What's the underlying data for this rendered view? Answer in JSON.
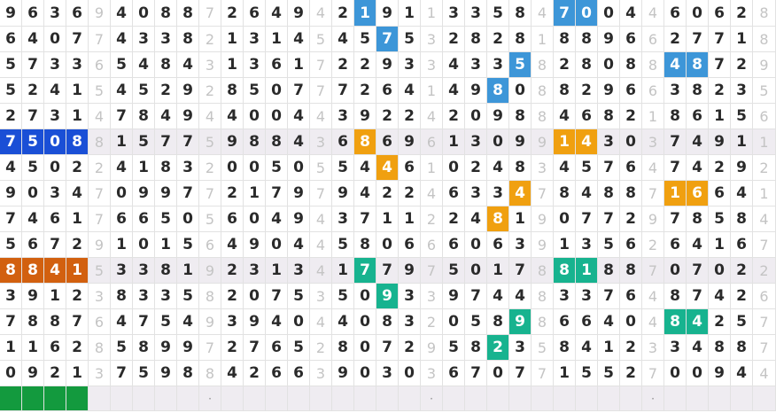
{
  "colors": {
    "blue_light": "#3d96d8",
    "blue_dark": "#1a4fd6",
    "orange": "#f0a010",
    "orange_dark": "#d2600f",
    "teal": "#17b38f",
    "green": "#139a3e",
    "stripe": "#efecf1",
    "white": "#ffffff"
  },
  "grid": {
    "rows": [
      [
        "9",
        "6",
        "3",
        "6",
        "9",
        "4",
        "0",
        "8",
        "8",
        "7",
        "2",
        "6",
        "4",
        "9",
        "4",
        "2",
        "1",
        "9",
        "1",
        "1",
        "3",
        "3",
        "5",
        "8",
        "4",
        "7",
        "0",
        "0",
        "4",
        "4",
        "6",
        "0",
        "6",
        "2",
        "8"
      ],
      [
        "6",
        "4",
        "0",
        "7",
        "7",
        "4",
        "3",
        "3",
        "8",
        "2",
        "1",
        "3",
        "1",
        "4",
        "5",
        "4",
        "5",
        "7",
        "5",
        "3",
        "2",
        "8",
        "2",
        "8",
        "1",
        "8",
        "8",
        "9",
        "6",
        "6",
        "2",
        "7",
        "7",
        "1",
        "8"
      ],
      [
        "5",
        "7",
        "3",
        "3",
        "6",
        "5",
        "4",
        "8",
        "4",
        "3",
        "1",
        "3",
        "6",
        "1",
        "7",
        "2",
        "2",
        "9",
        "3",
        "3",
        "4",
        "3",
        "3",
        "5",
        "8",
        "2",
        "8",
        "0",
        "8",
        "8",
        "4",
        "8",
        "7",
        "2",
        "9"
      ],
      [
        "5",
        "2",
        "4",
        "1",
        "5",
        "4",
        "5",
        "2",
        "9",
        "2",
        "8",
        "5",
        "0",
        "7",
        "7",
        "7",
        "2",
        "6",
        "4",
        "1",
        "4",
        "9",
        "8",
        "0",
        "8",
        "8",
        "2",
        "9",
        "6",
        "6",
        "3",
        "8",
        "2",
        "3",
        "5"
      ],
      [
        "2",
        "7",
        "3",
        "1",
        "4",
        "7",
        "8",
        "4",
        "9",
        "4",
        "4",
        "0",
        "0",
        "4",
        "4",
        "3",
        "9",
        "2",
        "2",
        "4",
        "2",
        "0",
        "9",
        "8",
        "8",
        "4",
        "6",
        "8",
        "2",
        "1",
        "8",
        "6",
        "1",
        "5",
        "6"
      ],
      [
        "7",
        "5",
        "0",
        "8",
        "8",
        "1",
        "5",
        "7",
        "7",
        "5",
        "9",
        "8",
        "8",
        "4",
        "3",
        "6",
        "8",
        "6",
        "9",
        "6",
        "1",
        "3",
        "0",
        "9",
        "9",
        "1",
        "4",
        "3",
        "0",
        "3",
        "7",
        "4",
        "9",
        "1",
        "1"
      ],
      [
        "4",
        "5",
        "0",
        "2",
        "2",
        "4",
        "1",
        "8",
        "3",
        "2",
        "0",
        "0",
        "5",
        "0",
        "5",
        "5",
        "4",
        "4",
        "6",
        "1",
        "0",
        "2",
        "4",
        "8",
        "3",
        "4",
        "5",
        "7",
        "6",
        "4",
        "7",
        "4",
        "2",
        "9",
        "2"
      ],
      [
        "9",
        "0",
        "3",
        "4",
        "7",
        "0",
        "9",
        "9",
        "7",
        "7",
        "2",
        "1",
        "7",
        "9",
        "7",
        "9",
        "4",
        "2",
        "2",
        "4",
        "6",
        "3",
        "3",
        "4",
        "7",
        "8",
        "4",
        "8",
        "8",
        "7",
        "1",
        "6",
        "6",
        "4",
        "1"
      ],
      [
        "7",
        "4",
        "6",
        "1",
        "7",
        "6",
        "6",
        "5",
        "0",
        "5",
        "6",
        "0",
        "4",
        "9",
        "4",
        "3",
        "7",
        "1",
        "1",
        "2",
        "2",
        "4",
        "8",
        "1",
        "9",
        "0",
        "7",
        "7",
        "2",
        "9",
        "7",
        "8",
        "5",
        "8",
        "4"
      ],
      [
        "5",
        "6",
        "7",
        "2",
        "9",
        "1",
        "0",
        "1",
        "5",
        "6",
        "4",
        "9",
        "0",
        "4",
        "4",
        "5",
        "8",
        "0",
        "6",
        "6",
        "6",
        "0",
        "6",
        "3",
        "9",
        "1",
        "3",
        "5",
        "6",
        "2",
        "6",
        "4",
        "1",
        "6",
        "7"
      ],
      [
        "8",
        "8",
        "4",
        "1",
        "5",
        "3",
        "3",
        "8",
        "1",
        "9",
        "2",
        "3",
        "1",
        "3",
        "4",
        "1",
        "7",
        "7",
        "9",
        "7",
        "5",
        "0",
        "1",
        "7",
        "8",
        "8",
        "1",
        "8",
        "8",
        "7",
        "0",
        "7",
        "0",
        "2",
        "2"
      ],
      [
        "3",
        "9",
        "1",
        "2",
        "3",
        "8",
        "3",
        "3",
        "5",
        "8",
        "2",
        "0",
        "7",
        "5",
        "3",
        "5",
        "0",
        "9",
        "3",
        "3",
        "9",
        "7",
        "4",
        "4",
        "8",
        "3",
        "3",
        "7",
        "6",
        "4",
        "8",
        "7",
        "4",
        "2",
        "6"
      ],
      [
        "7",
        "8",
        "8",
        "7",
        "6",
        "4",
        "7",
        "5",
        "4",
        "9",
        "3",
        "9",
        "4",
        "0",
        "4",
        "4",
        "0",
        "8",
        "3",
        "2",
        "0",
        "5",
        "8",
        "9",
        "8",
        "6",
        "6",
        "4",
        "0",
        "4",
        "8",
        "4",
        "2",
        "5",
        "7"
      ],
      [
        "1",
        "1",
        "6",
        "2",
        "8",
        "5",
        "8",
        "9",
        "9",
        "7",
        "2",
        "7",
        "6",
        "5",
        "2",
        "8",
        "0",
        "7",
        "2",
        "9",
        "5",
        "8",
        "2",
        "3",
        "5",
        "8",
        "4",
        "1",
        "2",
        "3",
        "3",
        "4",
        "8",
        "8",
        "7"
      ],
      [
        "0",
        "9",
        "2",
        "1",
        "3",
        "7",
        "5",
        "9",
        "8",
        "8",
        "4",
        "2",
        "6",
        "6",
        "3",
        "9",
        "0",
        "3",
        "0",
        "3",
        "6",
        "7",
        "0",
        "7",
        "7",
        "1",
        "5",
        "5",
        "2",
        "7",
        "0",
        "0",
        "9",
        "4",
        "4"
      ],
      [
        "",
        "",
        "",
        "",
        "",
        "",
        "",
        "",
        "",
        "·",
        "",
        "",
        "",
        "",
        "",
        "",
        "",
        "",
        "",
        "·",
        "",
        "",
        "",
        "",
        "",
        "",
        "",
        "",
        "",
        "·",
        "",
        "",
        "",
        "",
        ""
      ]
    ]
  }
}
